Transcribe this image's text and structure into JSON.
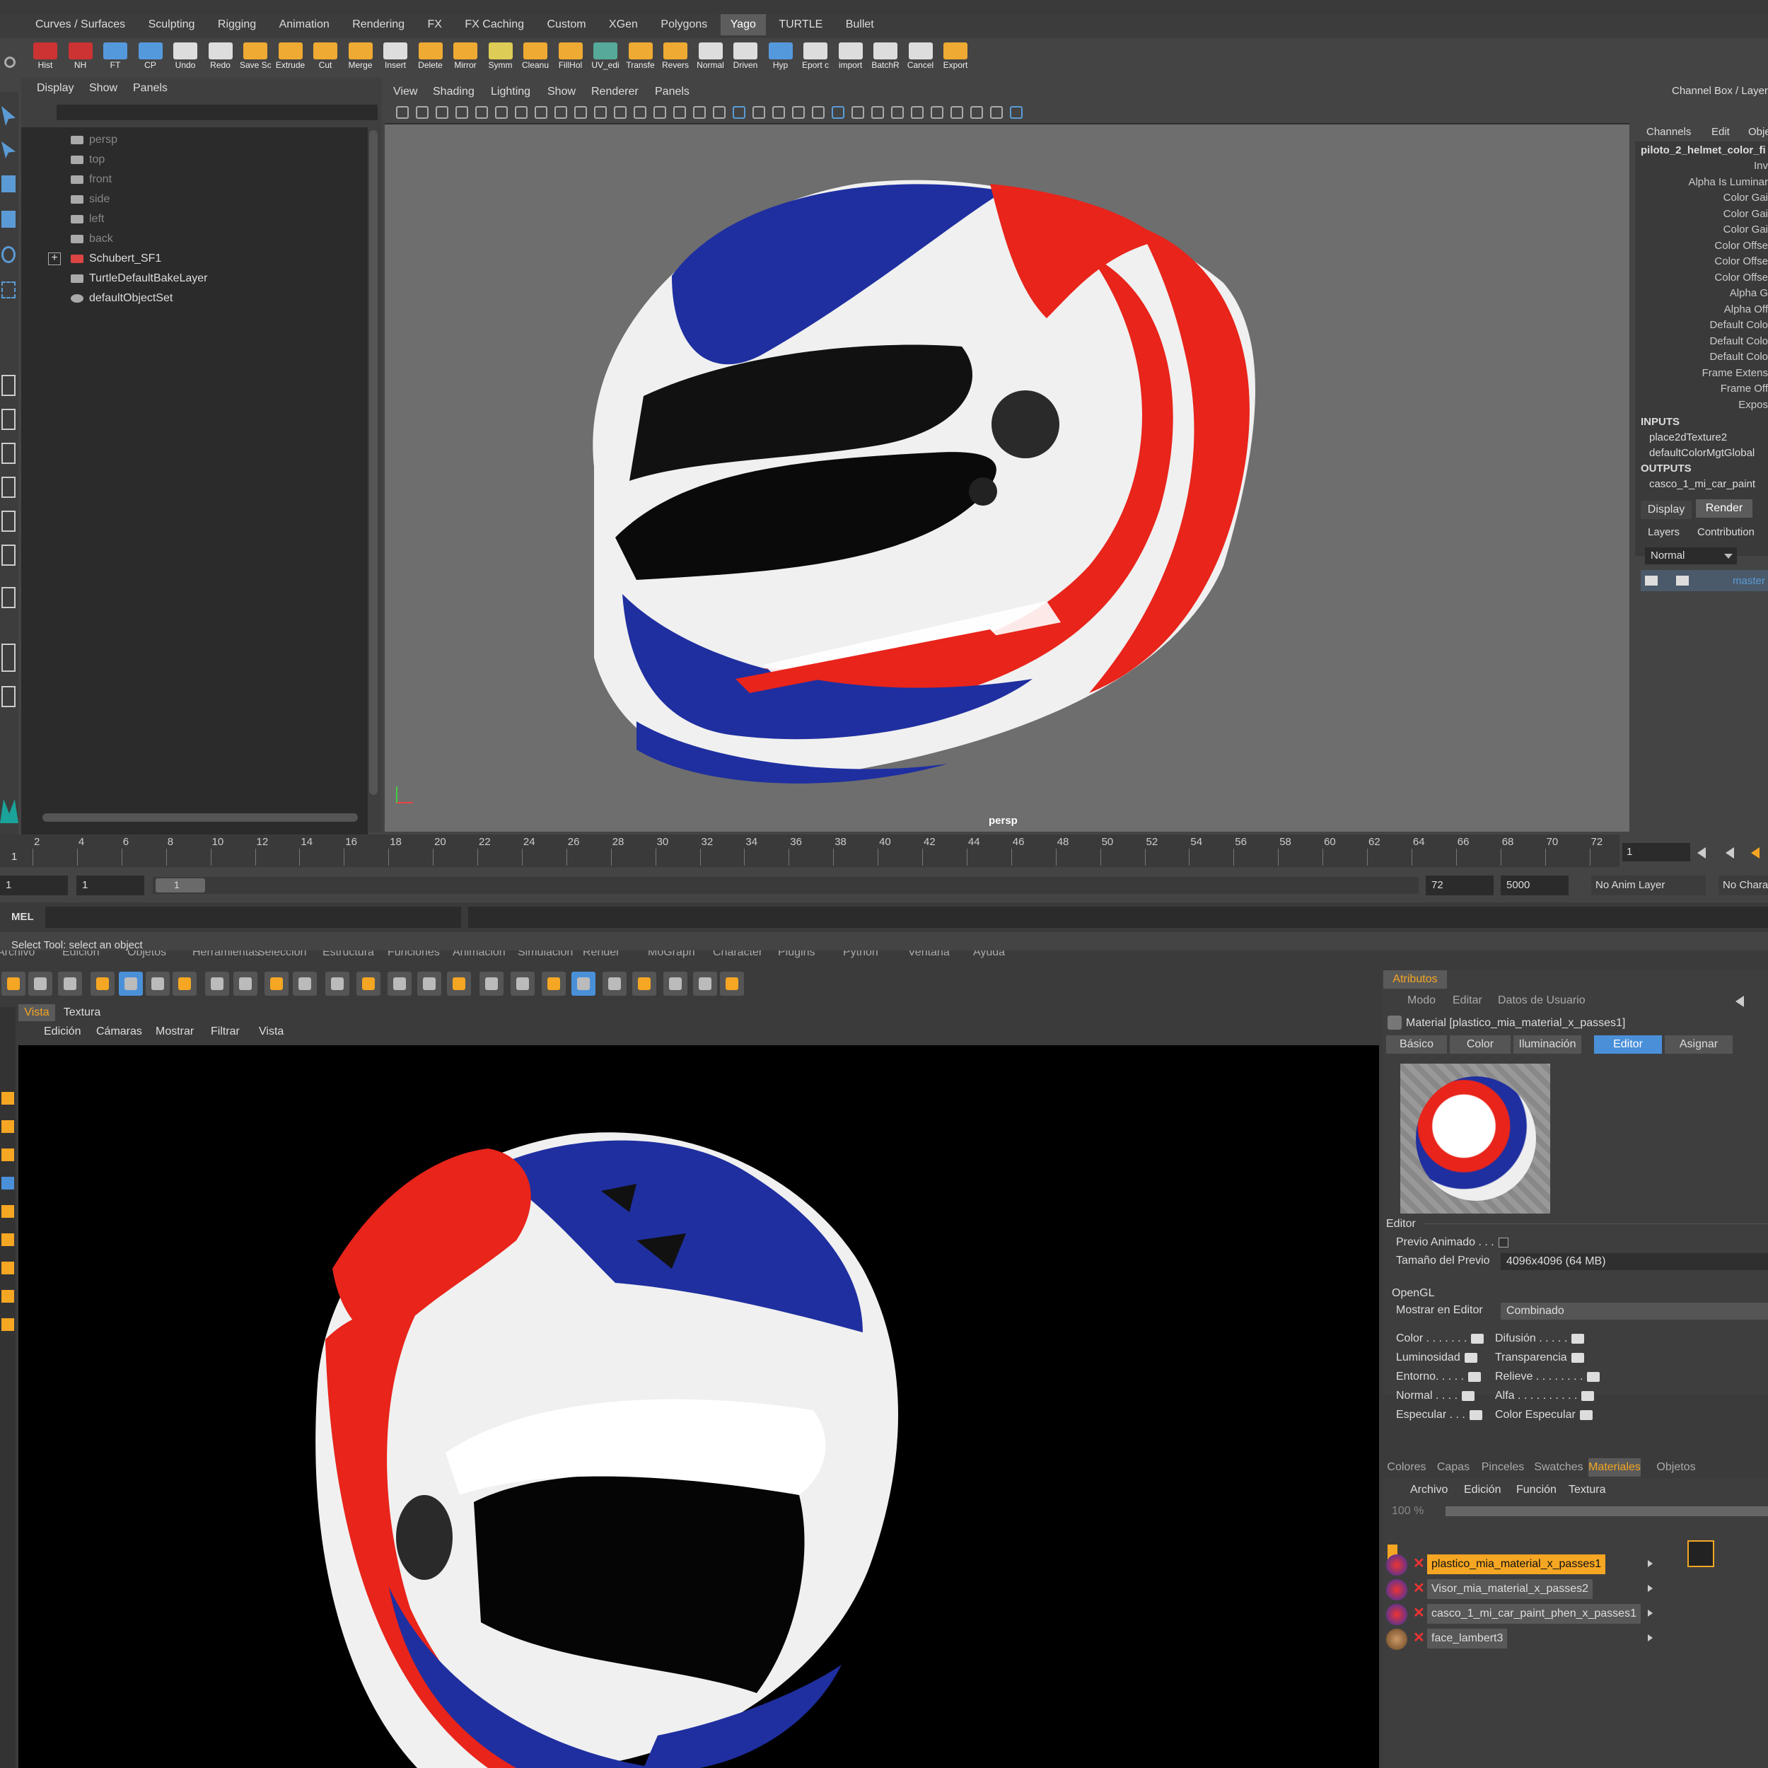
{
  "maya": {
    "menubar": [
      "Curves / Surfaces",
      "Sculpting",
      "Rigging",
      "Animation",
      "Rendering",
      "FX",
      "FX Caching",
      "Custom",
      "XGen",
      "Polygons",
      "Yago",
      "TURTLE",
      "Bullet"
    ],
    "active_tab": "Yago",
    "shelf": [
      "Hist",
      "NH",
      "FT",
      "CP",
      "Undo",
      "Redo",
      "Save Sc",
      "Extrude",
      "Cut",
      "Merge",
      "Insert",
      "Delete",
      "Mirror",
      "Symm",
      "Cleanu",
      "FillHol",
      "UV_edi",
      "Transfe",
      "Revers",
      "Normal",
      "Driven",
      "Hyp",
      "Eport c",
      "import",
      "BatchR",
      "Cancel",
      "Export"
    ],
    "outliner": {
      "menu": [
        "Display",
        "Show",
        "Panels"
      ],
      "items": [
        "persp",
        "top",
        "front",
        "side",
        "left",
        "back",
        "Schubert_SF1",
        "TurtleDefaultBakeLayer",
        "defaultObjectSet"
      ]
    },
    "viewport": {
      "menu": [
        "View",
        "Shading",
        "Lighting",
        "Show",
        "Renderer",
        "Panels"
      ],
      "camera_label": "persp"
    },
    "channel_box": {
      "title": "Channel Box / Layer",
      "menu": [
        "Channels",
        "Edit",
        "Obje"
      ],
      "node": "piloto_2_helmet_color_fi",
      "attrs": [
        "Inv",
        "Alpha Is Luminar",
        "Color Gai",
        "Color Gai",
        "Color Gai",
        "Color Offse",
        "Color Offse",
        "Color Offse",
        "Alpha G",
        "Alpha Off",
        "Default Colo",
        "Default Colo",
        "Default Colo",
        "Frame Extens",
        "Frame Off",
        "Expos"
      ],
      "inputs_label": "INPUTS",
      "inputs": [
        "place2dTexture2",
        "defaultColorMgtGlobal"
      ],
      "outputs_label": "OUTPUTS",
      "outputs": [
        "casco_1_mi_car_paint"
      ],
      "tabs": [
        "Display",
        "Render"
      ],
      "active_tab": "Render",
      "sub_tabs": [
        "Layers",
        "Contribution"
      ],
      "blend_mode": "Normal",
      "layer_name": "master"
    },
    "timeline": {
      "ticks": [
        "2",
        "4",
        "6",
        "8",
        "10",
        "12",
        "14",
        "16",
        "18",
        "20",
        "22",
        "24",
        "26",
        "28",
        "30",
        "32",
        "34",
        "36",
        "38",
        "40",
        "42",
        "44",
        "46",
        "48",
        "50",
        "52",
        "54",
        "56",
        "58",
        "60",
        "62",
        "64",
        "66",
        "68",
        "70",
        "72"
      ],
      "start_marker": "1",
      "current_frame": "1",
      "range_start": "1",
      "range_start2": "1",
      "range_chip": "1",
      "range_end": "72",
      "range_end2": "5000",
      "anim_layer": "No Anim Layer",
      "character": "No Chara"
    },
    "command_line": {
      "label": "MEL"
    },
    "help_line": "Select Tool: select an object"
  },
  "c4d": {
    "menubar": [
      "Archivo",
      "Edición",
      "Objetos",
      "Herramientas",
      "Selección",
      "Estructura",
      "Funciones",
      "Animación",
      "Simulación",
      "Render",
      "MoGraph",
      "Character",
      "Plugins",
      "Python",
      "Ventana",
      "Ayuda"
    ],
    "view_tabs": [
      "Vista",
      "Textura"
    ],
    "view_menu": [
      "Edición",
      "Cámaras",
      "Mostrar",
      "Filtrar",
      "Vista"
    ],
    "attributes": {
      "tab": "Atributos",
      "menu": [
        "Modo",
        "Editar",
        "Datos de Usuario"
      ],
      "material_title": "Material [plastico_mia_material_x_passes1]",
      "subtabs": [
        "Básico",
        "Color",
        "Iluminación",
        "Editor",
        "Asignar"
      ],
      "active_subtab": "Editor",
      "section": "Editor",
      "previo_animado": "Previo Animado . . .",
      "tamano_label": "Tamaño del Previo",
      "tamano_value": "4096x4096 (64 MB)",
      "opengl": "OpenGL",
      "mostrar_label": "Mostrar en Editor",
      "mostrar_value": "Combinado",
      "channels_left": [
        "Color . . . . . . .",
        "Luminosidad",
        "Entorno. . . . .",
        "Normal . . . .",
        "Especular . . ."
      ],
      "channels_right": [
        "Difusión . . . . .",
        "Transparencia",
        "Relieve . . . . . . . .",
        "Alfa . . . . . . . . . .",
        "Color Especular"
      ]
    },
    "manager_tabs": [
      "Colores",
      "Capas",
      "Pinceles",
      "Swatches",
      "Materiales",
      "Objetos"
    ],
    "active_manager_tab": "Materiales",
    "material_menu": [
      "Archivo",
      "Edición",
      "Función",
      "Textura"
    ],
    "zoom": "100 %",
    "materials": [
      "plastico_mia_material_x_passes1",
      "Visor_mia_material_x_passes2",
      "casco_1_mi_car_paint_phen_x_passes1",
      "face_lambert3"
    ],
    "selected_material": "plastico_mia_material_x_passes1"
  },
  "colors": {
    "highlight": "#5b9bd5",
    "selection": "#f5a623",
    "c4d_active": "#4a90d9",
    "helmet_blue": "#1f2fa0",
    "helmet_red": "#e8241b",
    "helmet_white": "#f0f0f0"
  }
}
